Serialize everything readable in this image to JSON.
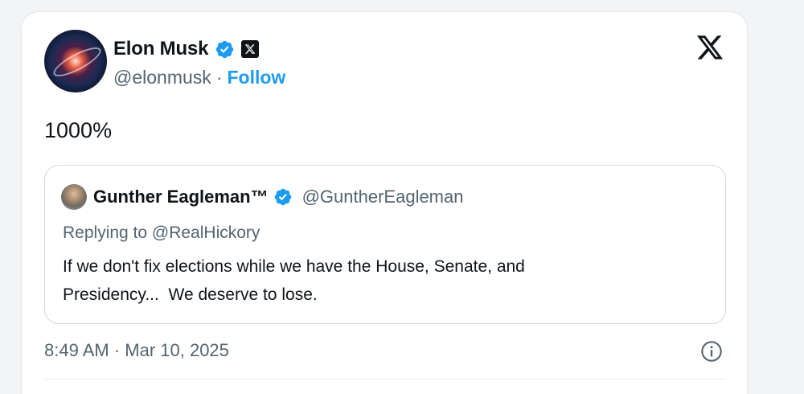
{
  "post": {
    "author_name": "Elon Musk",
    "author_handle": "@elonmusk",
    "separator": "·",
    "follow_label": "Follow",
    "text": "1000%",
    "timestamp": "8:49 AM · Mar 10, 2025"
  },
  "quoted_post": {
    "author_name": "Gunther Eagleman™",
    "author_handle": "@GuntherEagleman",
    "reply_context": "Replying to @RealHickory",
    "text_line1": "If we don't fix elections while we have the House, Senate, and",
    "text_line2": "Presidency...  We deserve to lose."
  },
  "icons": {
    "verified": "verified-badge-icon",
    "affiliate": "x-affiliate-icon",
    "platform": "x-logo-icon",
    "info": "info-icon"
  },
  "colors": {
    "accent": "#1d9bf0",
    "text_primary": "#0f1419",
    "text_secondary": "#536471",
    "border": "#cfd9de"
  }
}
